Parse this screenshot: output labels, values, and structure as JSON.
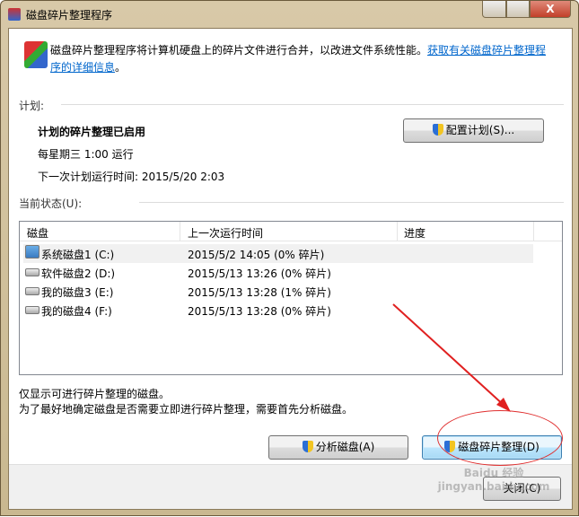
{
  "window": {
    "title": "磁盘碎片整理程序",
    "minimize": "minimize",
    "maximize": "maximize",
    "close": "X"
  },
  "intro": {
    "text": "磁盘碎片整理程序将计算机硬盘上的碎片文件进行合并，以改进文件系统性能。",
    "link_part1": "获取有关磁盘碎片整理程",
    "link_part2": "序的详细信息",
    "suffix": "。"
  },
  "schedule": {
    "section": "计划:",
    "status": "计划的碎片整理已启用",
    "frequency": "每星期三  1:00 运行",
    "next_run": "下一次计划运行时间: 2015/5/20 2:03",
    "configure_button": "配置计划(S)..."
  },
  "current": {
    "section": "当前状态(U):",
    "columns": [
      "磁盘",
      "上一次运行时间",
      "进度"
    ],
    "rows": [
      {
        "disk": "系统磁盘1 (C:)",
        "last_run": "2015/5/2 14:05 (0% 碎片)",
        "progress": ""
      },
      {
        "disk": "软件磁盘2 (D:)",
        "last_run": "2015/5/13 13:26 (0% 碎片)",
        "progress": ""
      },
      {
        "disk": "我的磁盘3 (E:)",
        "last_run": "2015/5/13 13:28 (1% 碎片)",
        "progress": ""
      },
      {
        "disk": "我的磁盘4 (F:)",
        "last_run": "2015/5/13 13:28 (0% 碎片)",
        "progress": ""
      }
    ]
  },
  "notes": {
    "line1": "仅显示可进行碎片整理的磁盘。",
    "line2": "为了最好地确定磁盘是否需要立即进行碎片整理，需要首先分析磁盘。"
  },
  "buttons": {
    "analyze": "分析磁盘(A)",
    "defrag": "磁盘碎片整理(D)",
    "close": "关闭(C)"
  },
  "watermark": "Baidu 经验 jingyan.baidu.com"
}
